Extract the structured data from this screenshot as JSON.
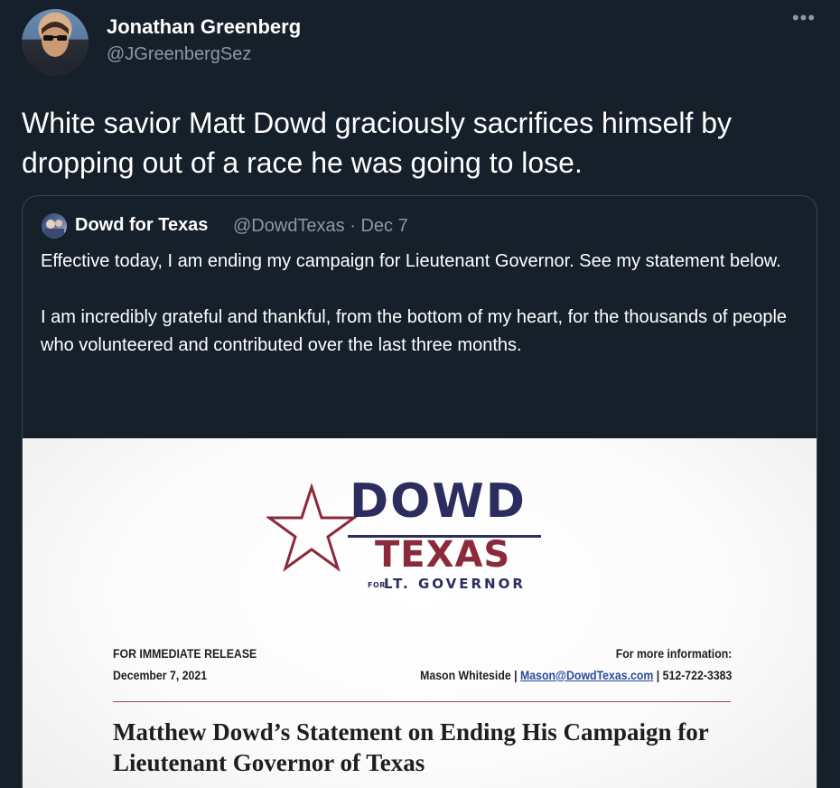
{
  "tweet": {
    "author_name": "Jonathan Greenberg",
    "author_handle": "@JGreenbergSez",
    "more_icon": "more-horizontal-icon",
    "text": "White savior Matt Dowd graciously sacrifices himself by dropping out of a race he was going to lose."
  },
  "quoted": {
    "name": "Dowd for Texas",
    "handle_date": "@DowdTexas · Dec 7",
    "paragraphs": [
      "Effective today, I am ending my campaign for Lieutenant Governor. See my statement below.",
      "I am incredibly grateful and thankful, from the bottom of my heart, for the thousands of people who volunteered and contributed over the last three months."
    ]
  },
  "press_release": {
    "logo": {
      "dowd": "DOWD",
      "texas": "TEXAS",
      "for": "FOR",
      "lt_governor": "LT. GOVERNOR"
    },
    "release_label": "FOR IMMEDIATE RELEASE",
    "release_date": "December 7, 2021",
    "info_label": "For more information:",
    "contact_name": "Mason Whiteside |",
    "contact_email": "Mason@DowdTexas.com",
    "contact_phone": "| 512-722-3383",
    "title": "Matthew Dowd’s Statement on Ending His Campaign for Lieutenant Governor of Texas"
  },
  "colors": {
    "background": "#15202b",
    "secondary_text": "#8b98a5",
    "logo_navy": "#2a2d5e",
    "logo_red": "#8a2a3b"
  }
}
